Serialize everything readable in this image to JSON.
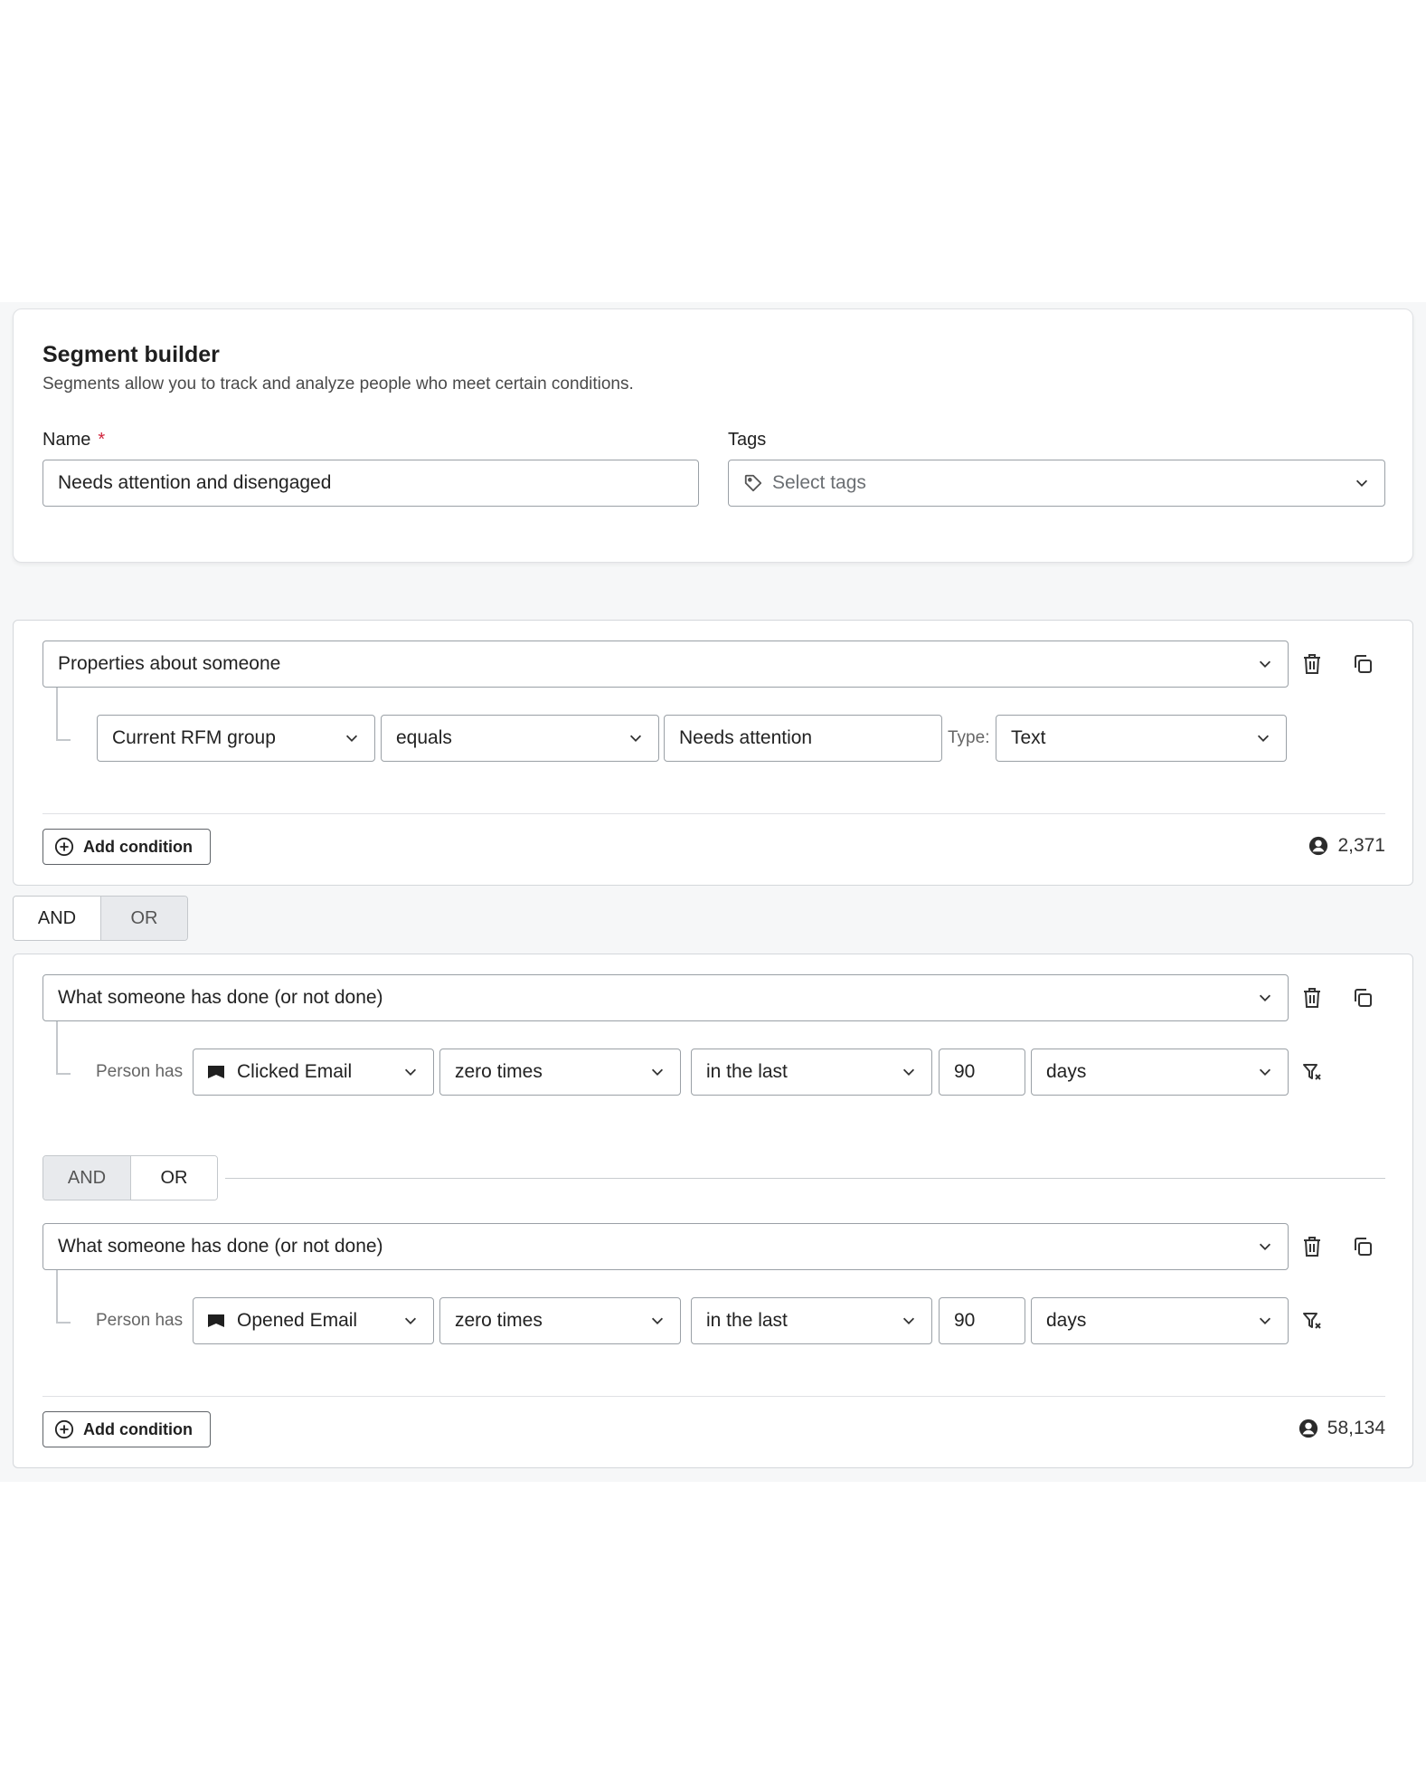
{
  "header": {
    "title": "Segment builder",
    "subtitle": "Segments allow you to track and analyze people who meet certain conditions.",
    "name_label": "Name",
    "required_mark": "*",
    "name_value": "Needs attention and disengaged",
    "tags_label": "Tags",
    "tags_placeholder": "Select tags"
  },
  "group1": {
    "definition": "Properties about someone",
    "property": "Current RFM group",
    "operator": "equals",
    "value": "Needs attention",
    "type_label": "Type:",
    "type_value": "Text",
    "add_condition": "Add condition",
    "count": "2,371"
  },
  "group_join": {
    "and": "AND",
    "or": "OR",
    "selected": "AND"
  },
  "group2": {
    "condition1": {
      "definition": "What someone has done (or not done)",
      "prefix": "Person has",
      "metric": "Clicked Email",
      "frequency": "zero times",
      "timeframe": "in the last",
      "amount": "90",
      "unit": "days"
    },
    "inner_join": {
      "and": "AND",
      "or": "OR",
      "selected": "OR"
    },
    "condition2": {
      "definition": "What someone has done (or not done)",
      "prefix": "Person has",
      "metric": "Opened Email",
      "frequency": "zero times",
      "timeframe": "in the last",
      "amount": "90",
      "unit": "days"
    },
    "add_condition": "Add condition",
    "count": "58,134"
  },
  "icons": [
    "tag-icon",
    "chevron-down-icon",
    "trash-icon",
    "copy-icon",
    "filter-icon",
    "plus-circle-icon",
    "person-icon",
    "flag-icon"
  ]
}
